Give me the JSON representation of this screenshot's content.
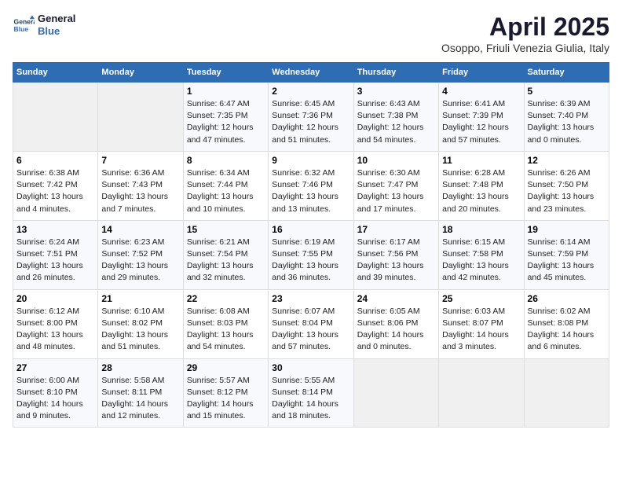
{
  "header": {
    "logo_line1": "General",
    "logo_line2": "Blue",
    "title": "April 2025",
    "subtitle": "Osoppo, Friuli Venezia Giulia, Italy"
  },
  "weekdays": [
    "Sunday",
    "Monday",
    "Tuesday",
    "Wednesday",
    "Thursday",
    "Friday",
    "Saturday"
  ],
  "weeks": [
    [
      {
        "day": "",
        "info": ""
      },
      {
        "day": "",
        "info": ""
      },
      {
        "day": "1",
        "info": "Sunrise: 6:47 AM\nSunset: 7:35 PM\nDaylight: 12 hours\nand 47 minutes."
      },
      {
        "day": "2",
        "info": "Sunrise: 6:45 AM\nSunset: 7:36 PM\nDaylight: 12 hours\nand 51 minutes."
      },
      {
        "day": "3",
        "info": "Sunrise: 6:43 AM\nSunset: 7:38 PM\nDaylight: 12 hours\nand 54 minutes."
      },
      {
        "day": "4",
        "info": "Sunrise: 6:41 AM\nSunset: 7:39 PM\nDaylight: 12 hours\nand 57 minutes."
      },
      {
        "day": "5",
        "info": "Sunrise: 6:39 AM\nSunset: 7:40 PM\nDaylight: 13 hours\nand 0 minutes."
      }
    ],
    [
      {
        "day": "6",
        "info": "Sunrise: 6:38 AM\nSunset: 7:42 PM\nDaylight: 13 hours\nand 4 minutes."
      },
      {
        "day": "7",
        "info": "Sunrise: 6:36 AM\nSunset: 7:43 PM\nDaylight: 13 hours\nand 7 minutes."
      },
      {
        "day": "8",
        "info": "Sunrise: 6:34 AM\nSunset: 7:44 PM\nDaylight: 13 hours\nand 10 minutes."
      },
      {
        "day": "9",
        "info": "Sunrise: 6:32 AM\nSunset: 7:46 PM\nDaylight: 13 hours\nand 13 minutes."
      },
      {
        "day": "10",
        "info": "Sunrise: 6:30 AM\nSunset: 7:47 PM\nDaylight: 13 hours\nand 17 minutes."
      },
      {
        "day": "11",
        "info": "Sunrise: 6:28 AM\nSunset: 7:48 PM\nDaylight: 13 hours\nand 20 minutes."
      },
      {
        "day": "12",
        "info": "Sunrise: 6:26 AM\nSunset: 7:50 PM\nDaylight: 13 hours\nand 23 minutes."
      }
    ],
    [
      {
        "day": "13",
        "info": "Sunrise: 6:24 AM\nSunset: 7:51 PM\nDaylight: 13 hours\nand 26 minutes."
      },
      {
        "day": "14",
        "info": "Sunrise: 6:23 AM\nSunset: 7:52 PM\nDaylight: 13 hours\nand 29 minutes."
      },
      {
        "day": "15",
        "info": "Sunrise: 6:21 AM\nSunset: 7:54 PM\nDaylight: 13 hours\nand 32 minutes."
      },
      {
        "day": "16",
        "info": "Sunrise: 6:19 AM\nSunset: 7:55 PM\nDaylight: 13 hours\nand 36 minutes."
      },
      {
        "day": "17",
        "info": "Sunrise: 6:17 AM\nSunset: 7:56 PM\nDaylight: 13 hours\nand 39 minutes."
      },
      {
        "day": "18",
        "info": "Sunrise: 6:15 AM\nSunset: 7:58 PM\nDaylight: 13 hours\nand 42 minutes."
      },
      {
        "day": "19",
        "info": "Sunrise: 6:14 AM\nSunset: 7:59 PM\nDaylight: 13 hours\nand 45 minutes."
      }
    ],
    [
      {
        "day": "20",
        "info": "Sunrise: 6:12 AM\nSunset: 8:00 PM\nDaylight: 13 hours\nand 48 minutes."
      },
      {
        "day": "21",
        "info": "Sunrise: 6:10 AM\nSunset: 8:02 PM\nDaylight: 13 hours\nand 51 minutes."
      },
      {
        "day": "22",
        "info": "Sunrise: 6:08 AM\nSunset: 8:03 PM\nDaylight: 13 hours\nand 54 minutes."
      },
      {
        "day": "23",
        "info": "Sunrise: 6:07 AM\nSunset: 8:04 PM\nDaylight: 13 hours\nand 57 minutes."
      },
      {
        "day": "24",
        "info": "Sunrise: 6:05 AM\nSunset: 8:06 PM\nDaylight: 14 hours\nand 0 minutes."
      },
      {
        "day": "25",
        "info": "Sunrise: 6:03 AM\nSunset: 8:07 PM\nDaylight: 14 hours\nand 3 minutes."
      },
      {
        "day": "26",
        "info": "Sunrise: 6:02 AM\nSunset: 8:08 PM\nDaylight: 14 hours\nand 6 minutes."
      }
    ],
    [
      {
        "day": "27",
        "info": "Sunrise: 6:00 AM\nSunset: 8:10 PM\nDaylight: 14 hours\nand 9 minutes."
      },
      {
        "day": "28",
        "info": "Sunrise: 5:58 AM\nSunset: 8:11 PM\nDaylight: 14 hours\nand 12 minutes."
      },
      {
        "day": "29",
        "info": "Sunrise: 5:57 AM\nSunset: 8:12 PM\nDaylight: 14 hours\nand 15 minutes."
      },
      {
        "day": "30",
        "info": "Sunrise: 5:55 AM\nSunset: 8:14 PM\nDaylight: 14 hours\nand 18 minutes."
      },
      {
        "day": "",
        "info": ""
      },
      {
        "day": "",
        "info": ""
      },
      {
        "day": "",
        "info": ""
      }
    ]
  ]
}
